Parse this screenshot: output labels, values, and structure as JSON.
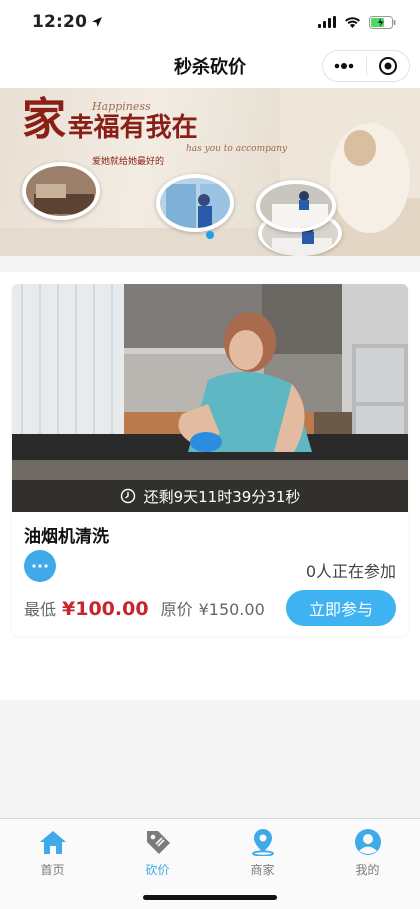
{
  "status_bar": {
    "time": "12:20"
  },
  "nav": {
    "title": "秒杀砍价"
  },
  "banner": {
    "big_char": "家",
    "headline": "幸福有我在",
    "script_line1": "Happiness",
    "script_line2": "has you to accompany",
    "small_text": "爱她就给她最好的"
  },
  "card": {
    "countdown": "还剩9天11时39分31秒",
    "title": "油烟机清洗",
    "participants": "0人正在参加",
    "price_label": "最低",
    "price_now": "¥100.00",
    "price_orig_label": "原价",
    "price_orig": "¥150.00",
    "join_label": "立即参与"
  },
  "tabs": [
    {
      "label": "首页",
      "icon": "home-icon",
      "active": false
    },
    {
      "label": "砍价",
      "icon": "tag-icon",
      "active": true
    },
    {
      "label": "商家",
      "icon": "location-icon",
      "active": false
    },
    {
      "label": "我的",
      "icon": "user-icon",
      "active": false
    }
  ],
  "colors": {
    "accent": "#3fa9e9",
    "price": "#c9252c",
    "button": "#3fb3f2"
  }
}
